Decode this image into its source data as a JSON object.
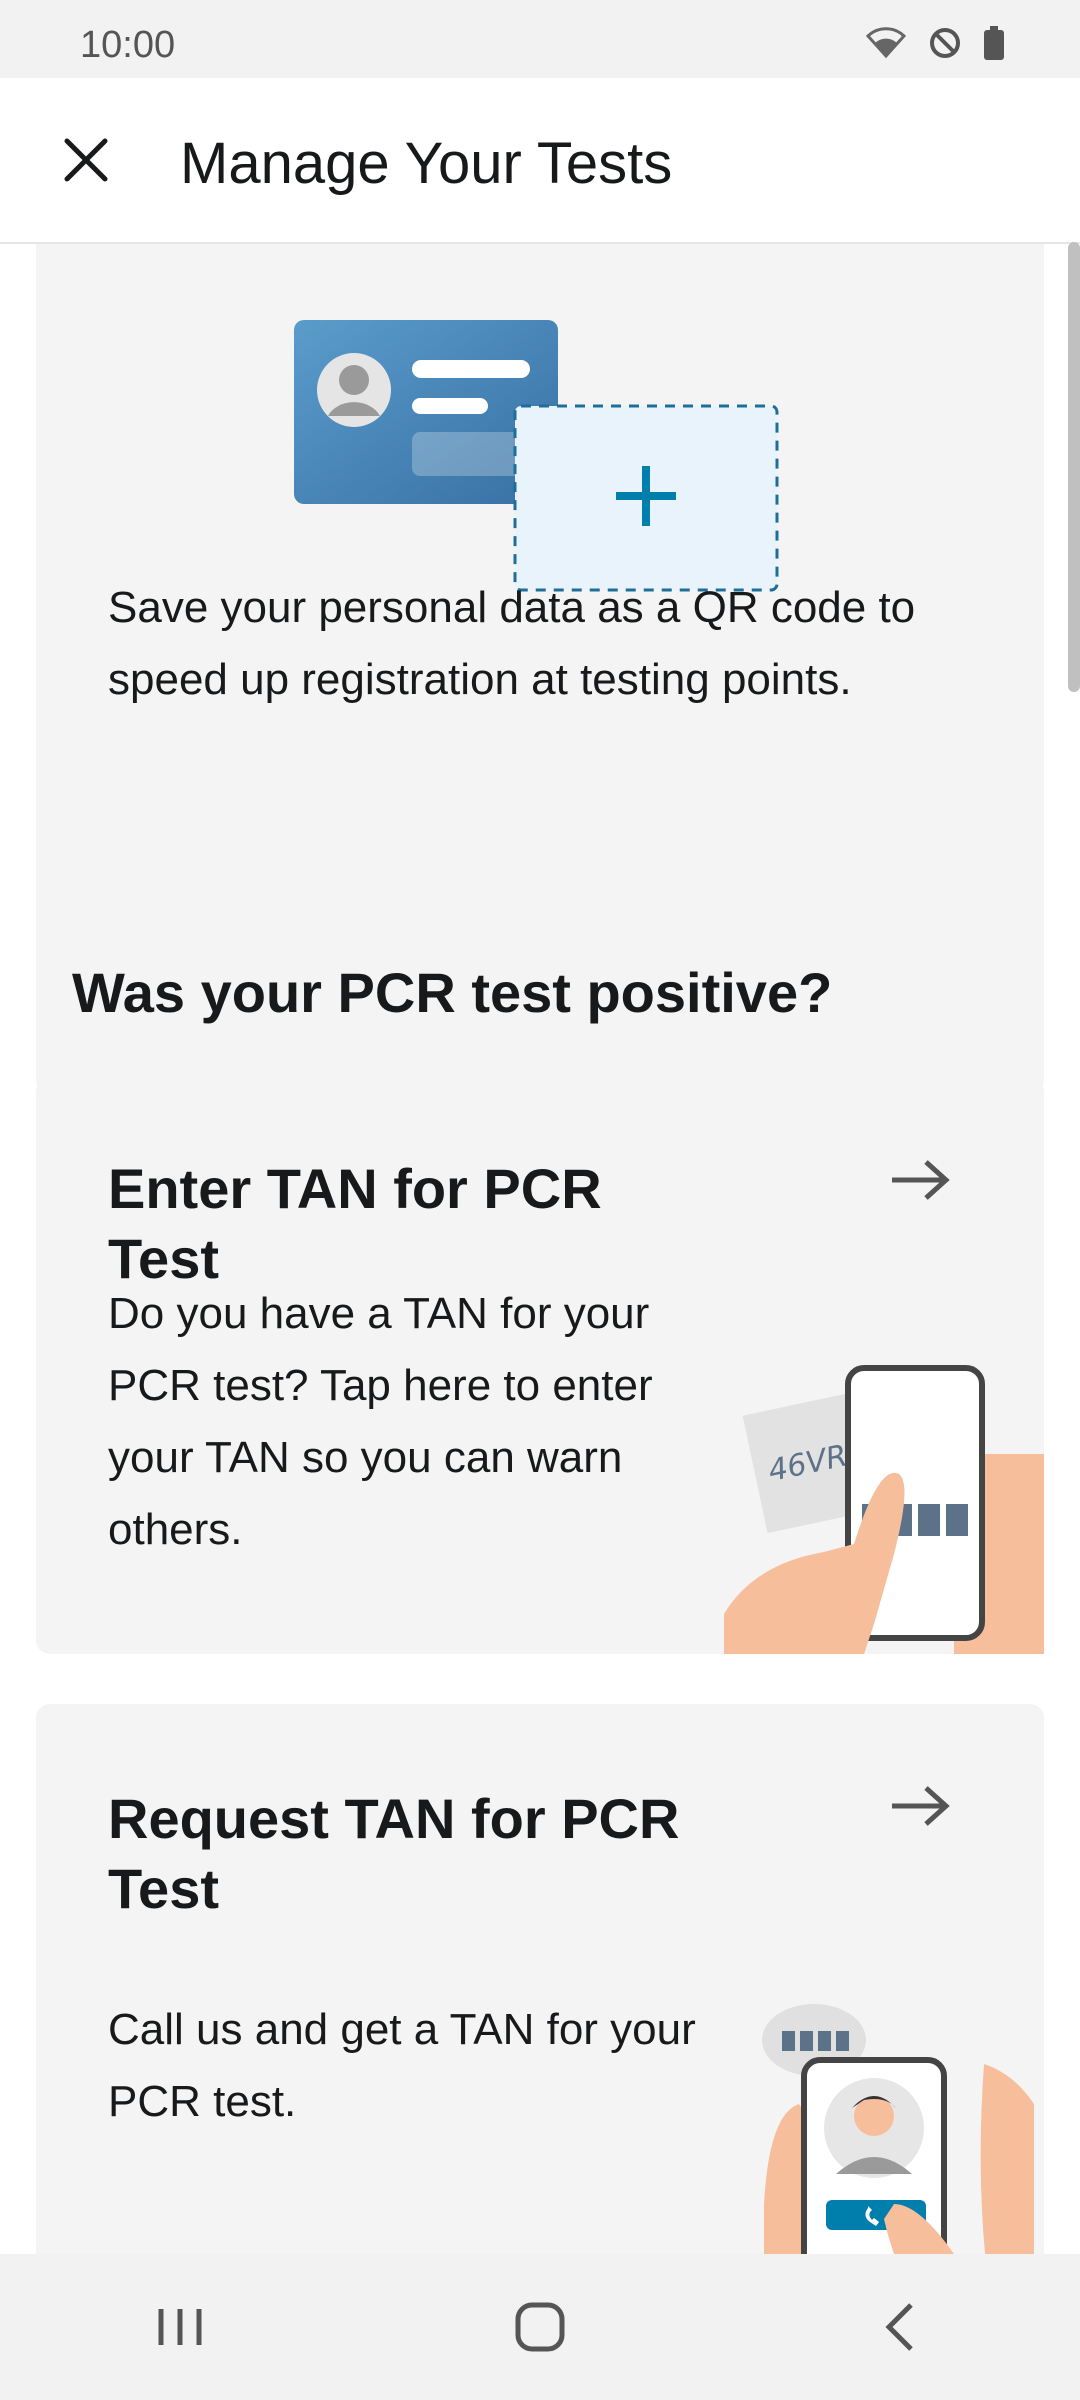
{
  "status_bar": {
    "time": "10:00",
    "icons": [
      "wifi-icon",
      "do-not-disturb-icon",
      "battery-icon"
    ]
  },
  "app_bar": {
    "title": "Manage Your Tests",
    "close_icon": "close-icon"
  },
  "profile_card": {
    "description": "Save your personal data as a QR code to speed up registration at testing points."
  },
  "section": {
    "heading": "Was your PCR test positive?"
  },
  "enter_tan_card": {
    "title": "Enter TAN for PCR Test",
    "body": "Do you have a TAN for your PCR test? Tap here to enter your TAN so you can warn others.",
    "illustration_code": "46VR"
  },
  "request_tan_card": {
    "title": "Request TAN for PCR Test",
    "body": "Call us and get a TAN for your PCR test."
  },
  "nav_bar": {
    "recents_icon": "recents-icon",
    "home_icon": "home-icon",
    "back_icon": "back-icon"
  },
  "colors": {
    "accent": "#007FAD",
    "card_bg": "#F4F4F4",
    "skin": "#F6BE9A"
  }
}
